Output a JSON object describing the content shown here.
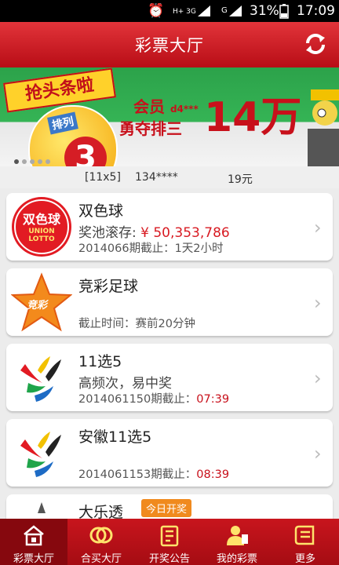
{
  "status_bar": {
    "network_1": "H+ 3G",
    "network_2": "G",
    "battery": "31%",
    "time": "17:09"
  },
  "header": {
    "title": "彩票大厅"
  },
  "banner": {
    "tag": "抢头条啦",
    "ball_text": "排列",
    "ball_number": "3",
    "member_label": "会员",
    "member_id": "d4***",
    "promo_line": "勇夺排三",
    "amount": "14万"
  },
  "ticker": {
    "game": "[11x5]",
    "user": "134****",
    "amount": "19元"
  },
  "lotteries": [
    {
      "name": "双色球",
      "logo_text": "双色球",
      "logo_sub": "UNION LOTTO",
      "line1_label": "奖池滚存:",
      "line1_value": "¥ 50,353,786",
      "line2_prefix": "2014066期截止：",
      "line2_value": "1天2小时"
    },
    {
      "name": "竞彩足球",
      "logo_text": "竞彩",
      "line2_prefix": "截止时间：",
      "line2_value": "赛前20分钟"
    },
    {
      "name": "11选5",
      "line1_text": "高频次，易中奖",
      "line2_prefix": "2014061150期截止：",
      "line2_value": "07:39"
    },
    {
      "name": "安徽11选5",
      "line2_prefix": "2014061153期截止：",
      "line2_value": "08:39"
    },
    {
      "name": "大乐透",
      "badge": "今日开奖"
    }
  ],
  "tabs": [
    {
      "label": "彩票大厅",
      "icon": "lottery-hall-icon"
    },
    {
      "label": "合买大厅",
      "icon": "group-buy-icon"
    },
    {
      "label": "开奖公告",
      "icon": "draw-results-icon"
    },
    {
      "label": "我的彩票",
      "icon": "my-lottery-icon"
    },
    {
      "label": "更多",
      "icon": "more-icon"
    }
  ],
  "colors": {
    "brand_red": "#c8101b",
    "banner_green": "#2ca24a",
    "badge_orange": "#f08a1e"
  }
}
